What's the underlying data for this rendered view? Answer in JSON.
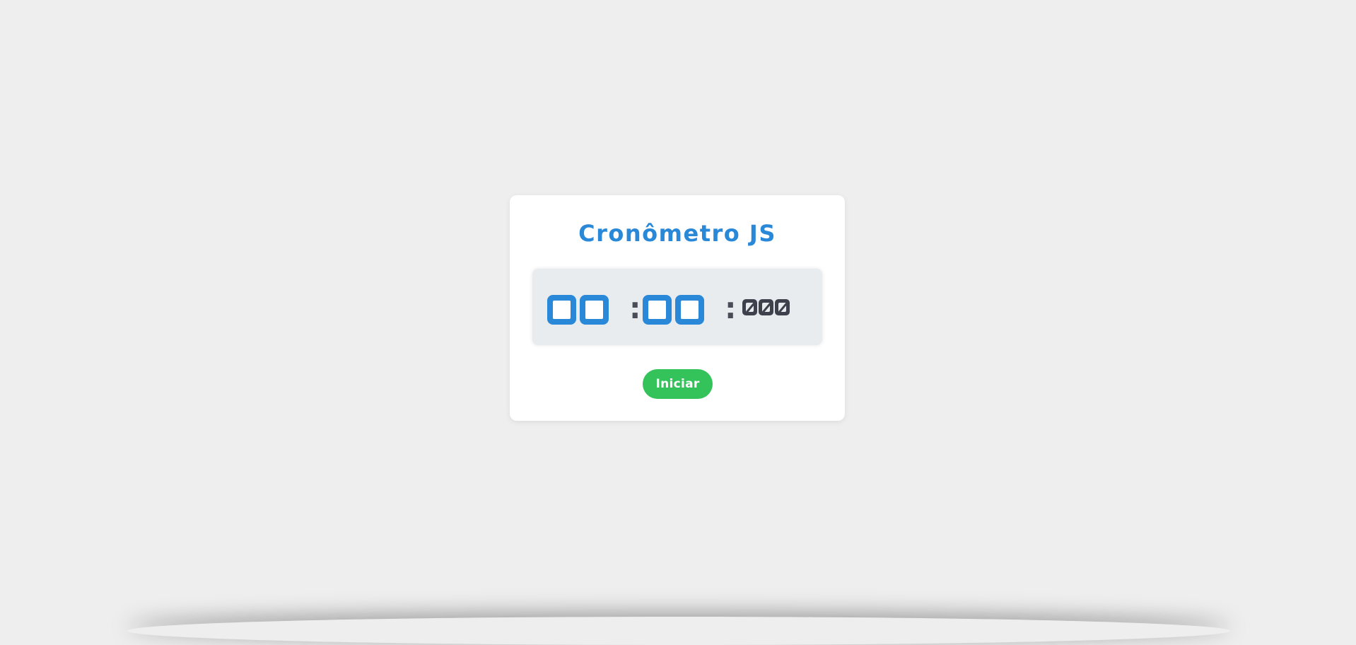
{
  "app": {
    "title": "Cronômetro JS"
  },
  "timer": {
    "minutes": "00",
    "seconds": "00",
    "milliseconds": "000",
    "separator": ":"
  },
  "controls": {
    "start_label": "Iniciar"
  },
  "colors": {
    "background": "#eeeeee",
    "card": "#ffffff",
    "accent_blue": "#2a88d8",
    "display_bg": "#e9ecef",
    "ms_digits": "#3d414c",
    "start_button": "#33c35a"
  }
}
